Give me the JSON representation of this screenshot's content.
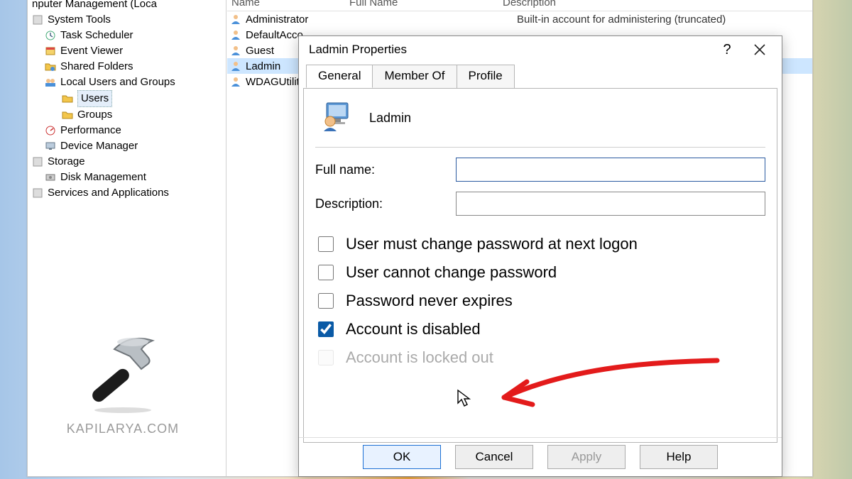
{
  "tree": {
    "root_partial": "nputer Management (Loca",
    "items": [
      {
        "label": "System Tools",
        "indent": 0,
        "icon": "wrench"
      },
      {
        "label": "Task Scheduler",
        "indent": 1,
        "icon": "clock"
      },
      {
        "label": "Event Viewer",
        "indent": 1,
        "icon": "event"
      },
      {
        "label": "Shared Folders",
        "indent": 1,
        "icon": "folder-share"
      },
      {
        "label": "Local Users and Groups",
        "indent": 1,
        "icon": "users-group"
      },
      {
        "label": "Users",
        "indent": 2,
        "icon": "folder",
        "selected": true
      },
      {
        "label": "Groups",
        "indent": 2,
        "icon": "folder"
      },
      {
        "label": "Performance",
        "indent": 1,
        "icon": "perf"
      },
      {
        "label": "Device Manager",
        "indent": 1,
        "icon": "device"
      },
      {
        "label": "Storage",
        "indent": 0,
        "icon": "storage"
      },
      {
        "label": "Disk Management",
        "indent": 1,
        "icon": "disk"
      },
      {
        "label": "Services and Applications",
        "indent": 0,
        "icon": "services"
      }
    ]
  },
  "columns": {
    "name": "Name",
    "fullname": "Full Name",
    "description": "Description"
  },
  "users": [
    {
      "name": "Administrator",
      "desc": "Built-in account for administering (truncated)"
    },
    {
      "name": "DefaultAcco...",
      "desc": ""
    },
    {
      "name": "Guest",
      "desc": ""
    },
    {
      "name": "Ladmin",
      "desc": "",
      "selected": true
    },
    {
      "name": "WDAGUtility.",
      "desc": ""
    }
  ],
  "dialog": {
    "title": "Ladmin Properties",
    "help": "?",
    "tabs": {
      "general": "General",
      "member": "Member Of",
      "profile": "Profile"
    },
    "username": "Ladmin",
    "fields": {
      "fullname_label": "Full name:",
      "fullname_value": "",
      "description_label": "Description:",
      "description_value": ""
    },
    "checks": {
      "must_change": "User must change password at next logon",
      "cannot_change": "User cannot change password",
      "never_expires": "Password never expires",
      "disabled": "Account is disabled",
      "locked": "Account is locked out"
    },
    "states": {
      "must_change": false,
      "cannot_change": false,
      "never_expires": false,
      "disabled": true,
      "locked": false
    },
    "buttons": {
      "ok": "OK",
      "cancel": "Cancel",
      "apply": "Apply",
      "help": "Help"
    }
  },
  "watermark": "KAPILARYA.COM"
}
